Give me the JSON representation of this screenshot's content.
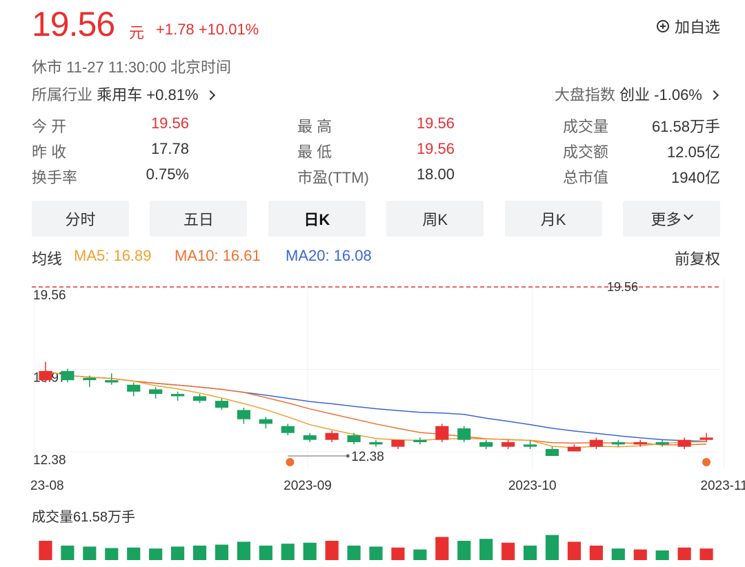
{
  "header": {
    "price": "19.56",
    "unit": "元",
    "change": "+1.78 +10.01%",
    "add_watch_label": "加自选",
    "status": "休市  11-27 11:30:00  北京时间"
  },
  "industry": {
    "label": "所属行业",
    "name": "乘用车",
    "change": "+0.81%"
  },
  "market_index": {
    "label": "大盘指数",
    "name": "创业",
    "change": "-1.06%"
  },
  "quote_stats": [
    [
      {
        "label": "今  开",
        "value": "19.56",
        "color": "#e93030"
      },
      {
        "label": "最  高",
        "value": "19.56",
        "color": "#e93030"
      },
      {
        "label": "成交量",
        "value": "61.58万手",
        "color": "#333333"
      }
    ],
    [
      {
        "label": "昨  收",
        "value": "17.78",
        "color": "#333333"
      },
      {
        "label": "最  低",
        "value": "19.56",
        "color": "#e93030"
      },
      {
        "label": "成交额",
        "value": "12.05亿",
        "color": "#333333"
      }
    ],
    [
      {
        "label": "换手率",
        "value": "0.75%",
        "color": "#333333"
      },
      {
        "label": "市盈(TTM)",
        "value": "18.00",
        "color": "#333333"
      },
      {
        "label": "总市值",
        "value": "1940亿",
        "color": "#333333"
      }
    ]
  ],
  "tabs": [
    "分时",
    "五日",
    "日K",
    "周K",
    "月K",
    "更多"
  ],
  "active_tab": "日K",
  "ma_legend": {
    "title": "均线",
    "ma5": "MA5: 16.89",
    "ma10": "MA10: 16.61",
    "ma20": "MA20: 16.08",
    "adjust": "前复权"
  },
  "volume_label": "成交量61.58万手",
  "colors": {
    "up": "#e93030",
    "down": "#1aa260",
    "ma5": "#f0a030",
    "ma10": "#f07030",
    "ma20": "#3a66d8",
    "accent": "#e93030"
  },
  "chart_data": {
    "type": "candlestick",
    "y_tick_labels": [
      "19.56",
      "15.97",
      "12.38"
    ],
    "ylim": [
      12.38,
      19.56
    ],
    "x_tick_labels": [
      "23-08",
      "2023-09",
      "2023-10",
      "2023-11"
    ],
    "x_tick_index": [
      0,
      12.4,
      22.6,
      31.3
    ],
    "last_price_marker": "19.56",
    "low_marker": {
      "label": "12.38",
      "index": 11.5
    },
    "event_dot_index": [
      11.6,
      30.5
    ],
    "candles": [
      {
        "o": 15.5,
        "c": 15.9,
        "h": 16.3,
        "l": 15.4,
        "v": 0.4
      },
      {
        "o": 15.9,
        "c": 15.5,
        "h": 16.0,
        "l": 15.4,
        "v": 0.3
      },
      {
        "o": 15.6,
        "c": 15.5,
        "h": 15.7,
        "l": 15.2,
        "v": 0.28
      },
      {
        "o": 15.5,
        "c": 15.4,
        "h": 15.8,
        "l": 15.3,
        "v": 0.25
      },
      {
        "o": 15.3,
        "c": 15.0,
        "h": 15.4,
        "l": 14.8,
        "v": 0.26
      },
      {
        "o": 15.1,
        "c": 14.9,
        "h": 15.2,
        "l": 14.7,
        "v": 0.24
      },
      {
        "o": 14.9,
        "c": 14.8,
        "h": 15.0,
        "l": 14.6,
        "v": 0.28
      },
      {
        "o": 14.8,
        "c": 14.6,
        "h": 14.9,
        "l": 14.5,
        "v": 0.3
      },
      {
        "o": 14.6,
        "c": 14.3,
        "h": 14.7,
        "l": 14.2,
        "v": 0.32
      },
      {
        "o": 14.2,
        "c": 13.8,
        "h": 14.3,
        "l": 13.6,
        "v": 0.38
      },
      {
        "o": 13.8,
        "c": 13.6,
        "h": 13.9,
        "l": 13.4,
        "v": 0.3
      },
      {
        "o": 13.5,
        "c": 13.2,
        "h": 13.6,
        "l": 13.1,
        "v": 0.34
      },
      {
        "o": 13.1,
        "c": 12.9,
        "h": 13.2,
        "l": 12.8,
        "v": 0.36
      },
      {
        "o": 12.9,
        "c": 13.2,
        "h": 13.3,
        "l": 12.8,
        "v": 0.4
      },
      {
        "o": 13.1,
        "c": 12.8,
        "h": 13.2,
        "l": 12.7,
        "v": 0.3
      },
      {
        "o": 12.8,
        "c": 12.7,
        "h": 12.9,
        "l": 12.6,
        "v": 0.28
      },
      {
        "o": 12.6,
        "c": 12.9,
        "h": 12.9,
        "l": 12.5,
        "v": 0.26
      },
      {
        "o": 12.9,
        "c": 12.8,
        "h": 13.0,
        "l": 12.7,
        "v": 0.22
      },
      {
        "o": 12.9,
        "c": 13.5,
        "h": 13.6,
        "l": 12.8,
        "v": 0.48
      },
      {
        "o": 13.4,
        "c": 12.9,
        "h": 13.5,
        "l": 12.8,
        "v": 0.4
      },
      {
        "o": 12.8,
        "c": 12.6,
        "h": 12.9,
        "l": 12.5,
        "v": 0.44
      },
      {
        "o": 12.6,
        "c": 12.8,
        "h": 12.9,
        "l": 12.5,
        "v": 0.36
      },
      {
        "o": 12.7,
        "c": 12.6,
        "h": 12.9,
        "l": 12.5,
        "v": 0.3
      },
      {
        "o": 12.5,
        "c": 12.2,
        "h": 12.6,
        "l": 12.38,
        "v": 0.52
      },
      {
        "o": 12.4,
        "c": 12.6,
        "h": 12.7,
        "l": 12.4,
        "v": 0.38
      },
      {
        "o": 12.6,
        "c": 12.9,
        "h": 13.0,
        "l": 12.5,
        "v": 0.3
      },
      {
        "o": 12.8,
        "c": 12.7,
        "h": 12.9,
        "l": 12.6,
        "v": 0.24
      },
      {
        "o": 12.7,
        "c": 12.8,
        "h": 12.9,
        "l": 12.6,
        "v": 0.22
      },
      {
        "o": 12.8,
        "c": 12.7,
        "h": 12.9,
        "l": 12.6,
        "v": 0.2
      },
      {
        "o": 12.6,
        "c": 12.9,
        "h": 13.0,
        "l": 12.5,
        "v": 0.26
      },
      {
        "o": 12.9,
        "c": 13.0,
        "h": 13.2,
        "l": 12.8,
        "v": 0.24
      }
    ],
    "volume_ylim": [
      0,
      1.0
    ]
  }
}
